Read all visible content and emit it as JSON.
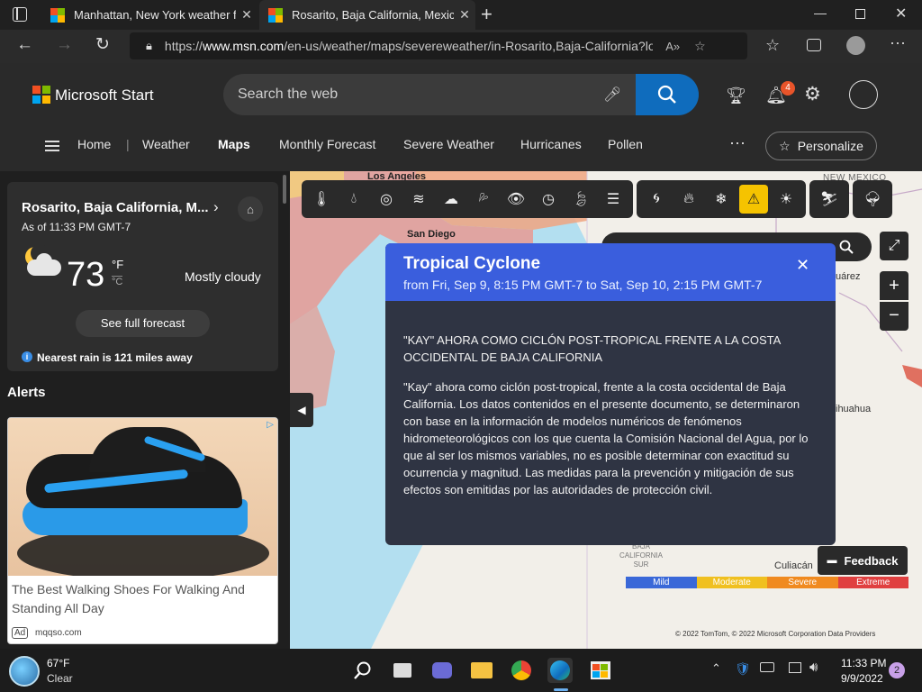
{
  "browser": {
    "tabs": [
      {
        "title": "Manhattan, New York weather fo",
        "active": false
      },
      {
        "title": "Rosarito, Baja California, Mexico",
        "active": true
      }
    ],
    "url_prefix": "https://",
    "url_domain": "www.msn.com",
    "url_rest": "/en-us/weather/maps/severeweather/in-Rosarito,Baja-California?lo..."
  },
  "msn": {
    "brand": "Microsoft Start",
    "search_placeholder": "Search the web",
    "notification_count": "4",
    "nav": [
      "Home",
      "Weather",
      "Maps",
      "Monthly Forecast",
      "Severe Weather",
      "Hurricanes",
      "Pollen"
    ],
    "personalize_label": "Personalize"
  },
  "weather_card": {
    "location": "Rosarito, Baja California, M...",
    "as_of": "As of 11:33 PM GMT-7",
    "temperature": "73",
    "unit_f": "°F",
    "unit_c": "°C",
    "condition": "Mostly cloudy",
    "forecast_button": "See full forecast",
    "rain_note": "Nearest rain is 121 miles away"
  },
  "alerts": {
    "heading": "Alerts"
  },
  "ad": {
    "title": "The Best Walking Shoes For Walking And Standing All Day",
    "badge": "Ad",
    "source": "mqqso.com"
  },
  "map": {
    "labels": {
      "los_angeles": "Los Angeles",
      "san_diego": "San Diego",
      "new_mexico": "NEW MEXICO",
      "juarez": "uárez",
      "chihuahua": "ihuahua",
      "baja_sur": "BAJA\nCALIFORNIA\nSUR",
      "culiacan": "Culiacán"
    },
    "legend": [
      "Mild",
      "Moderate",
      "Severe",
      "Extreme"
    ],
    "legend_colors": [
      "#3a68d8",
      "#f0c020",
      "#f08a20",
      "#e04040"
    ],
    "attribution": "© 2022 TomTom, © 2022 Microsoft Corporation  Data Providers",
    "feedback_label": "Feedback"
  },
  "popup": {
    "title": "Tropical Cyclone",
    "subtitle": "from Fri, Sep 9, 8:15 PM GMT-7 to Sat, Sep 10, 2:15 PM GMT-7",
    "headline": "\"KAY\" AHORA COMO CICLÓN POST-TROPICAL FRENTE A LA COSTA OCCIDENTAL DE BAJA CALIFORNIA",
    "body": "\"Kay\" ahora como ciclón post-tropical, frente a la costa occidental de Baja California. Los datos contenidos en el presente documento, se determinaron con base en la información de modelos numéricos de fenómenos hidrometeorológicos con los que cuenta la Comisión Nacional del Agua, por lo que al ser los mismos variables, no es posible determinar con exactitud su ocurrencia y magnitud. Las medidas para la prevención y mitigación de sus efectos son emitidas por las autoridades de protección civil."
  },
  "taskbar": {
    "weather_temp": "67°F",
    "weather_cond": "Clear",
    "time": "11:33 PM",
    "date": "9/9/2022",
    "notif_count": "2"
  }
}
